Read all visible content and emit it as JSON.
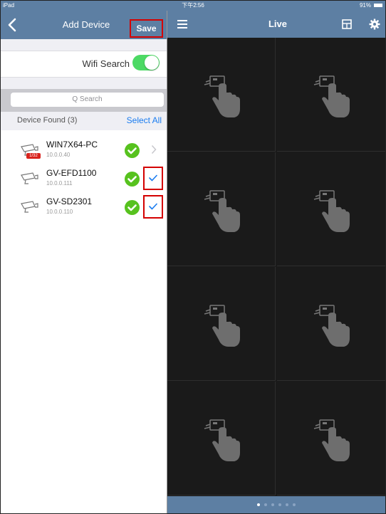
{
  "status_bar": {
    "device": "iPad",
    "time": "下午2:56",
    "battery": "91%"
  },
  "left_panel": {
    "title": "Add Device",
    "save_label": "Save",
    "wifi_search_label": "Wifi Search",
    "wifi_search_on": true,
    "search_placeholder": "Q Search",
    "section_title": "Device Found (3)",
    "select_all_label": "Select All",
    "devices": [
      {
        "name": "WIN7X64-PC",
        "ip": "10.0.0.40",
        "badge": "1/32",
        "checked": false
      },
      {
        "name": "GV-EFD1100",
        "ip": "10.0.0.111",
        "badge": "",
        "checked": true
      },
      {
        "name": "GV-SD2301",
        "ip": "10.0.0.110",
        "badge": "",
        "checked": true
      }
    ]
  },
  "right_panel": {
    "title": "Live",
    "page_count": 6,
    "active_page": 1
  },
  "colors": {
    "nav_bar": "#5d7fa3",
    "accent_blue": "#1a7cf0",
    "toggle_on": "#4cd964",
    "ok_green": "#57c21e",
    "highlight_red": "#d40000"
  }
}
